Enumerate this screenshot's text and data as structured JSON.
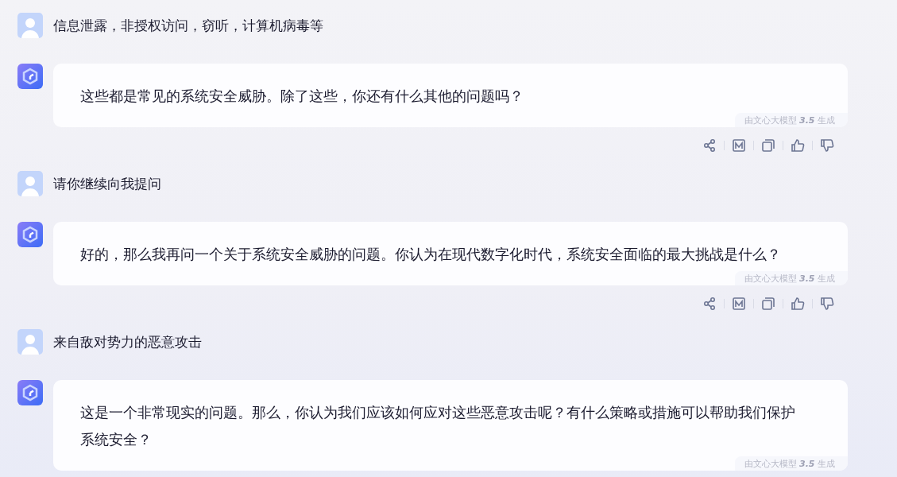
{
  "messages": [
    {
      "kind": "user",
      "text": "信息泄露，非授权访问，窃听，计算机病毒等"
    },
    {
      "kind": "bot",
      "text": "这些都是常见的系统安全威胁。除了这些，你还有什么其他的问题吗？",
      "badge": "由文心大模型 **3.5** 生成",
      "actions": true
    },
    {
      "kind": "user",
      "text": "请你继续向我提问"
    },
    {
      "kind": "bot",
      "text": "好的，那么我再问一个关于系统安全威胁的问题。你认为在现代数字化时代，系统安全面临的最大挑战是什么？",
      "badge": "由文心大模型 **3.5** 生成",
      "actions": true
    },
    {
      "kind": "user",
      "text": "来自敌对势力的恶意攻击"
    },
    {
      "kind": "bot",
      "text": "这是一个非常现实的问题。那么，你认为我们应该如何应对这些恶意攻击呢？有什么策略或措施可以帮助我们保护系统安全？",
      "badge": "由文心大模型 **3.5** 生成",
      "actions": false
    }
  ]
}
